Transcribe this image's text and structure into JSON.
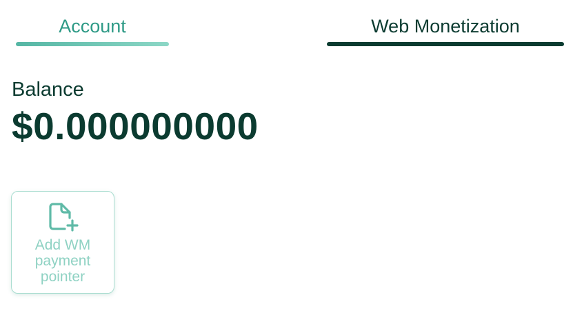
{
  "tabs": {
    "account": {
      "label": "Account",
      "active": false
    },
    "web_monetization": {
      "label": "Web Monetization",
      "active": true
    }
  },
  "balance": {
    "label": "Balance",
    "value": "$0.000000000"
  },
  "add_pointer": {
    "icon": "file-plus-icon",
    "label": "Add WM payment pointer"
  },
  "colors": {
    "text_dark": "#0b3b30",
    "accent": "#2e9a86",
    "accent_light": "#8fd2c3",
    "card_border": "#a9ddd0"
  }
}
